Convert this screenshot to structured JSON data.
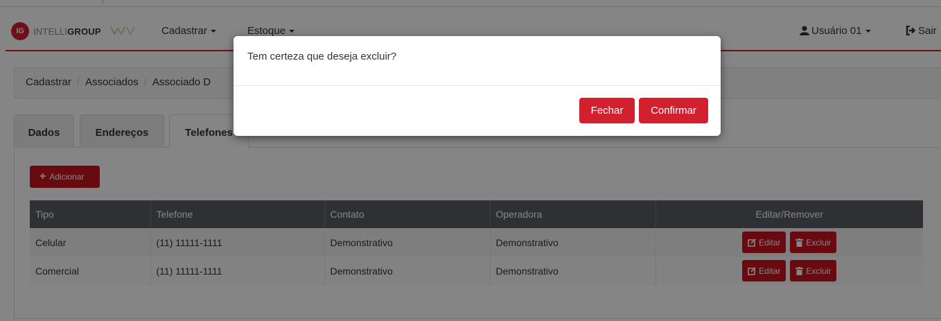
{
  "brand": {
    "badge": "IG",
    "name_thin": "INTELLI",
    "name_bold": "GROUP"
  },
  "nav": {
    "menu": [
      {
        "label": "Cadastrar"
      },
      {
        "label": "Estoque"
      }
    ],
    "user_label": "Usuário 01",
    "logout_label": "Sair"
  },
  "breadcrumb": [
    "Cadastrar",
    "Associados",
    "Associado D"
  ],
  "tabs": [
    {
      "label": "Dados",
      "active": false
    },
    {
      "label": "Endereços",
      "active": false
    },
    {
      "label": "Telefones",
      "active": true
    }
  ],
  "add_button_label": "Adicionar",
  "table": {
    "headers": [
      "Tipo",
      "Telefone",
      "Contato",
      "Operadora",
      "Editar/Remover"
    ],
    "rows": [
      {
        "tipo": "Celular",
        "telefone": "(11) 11111-1111",
        "contato": "Demonstrativo",
        "operadora": "Demonstrativo",
        "edit_label": "Editar",
        "delete_label": "Excluir"
      },
      {
        "tipo": "Comercial",
        "telefone": "(11) 11111-1111",
        "contato": "Demonstrativo",
        "operadora": "Demonstrativo",
        "edit_label": "Editar",
        "delete_label": "Excluir"
      }
    ]
  },
  "modal": {
    "message": "Tem certeza que deseja excluir?",
    "close_label": "Fechar",
    "confirm_label": "Confirmar"
  },
  "colors": {
    "accent": "#d3202f",
    "table_header": "#5a5d62"
  }
}
